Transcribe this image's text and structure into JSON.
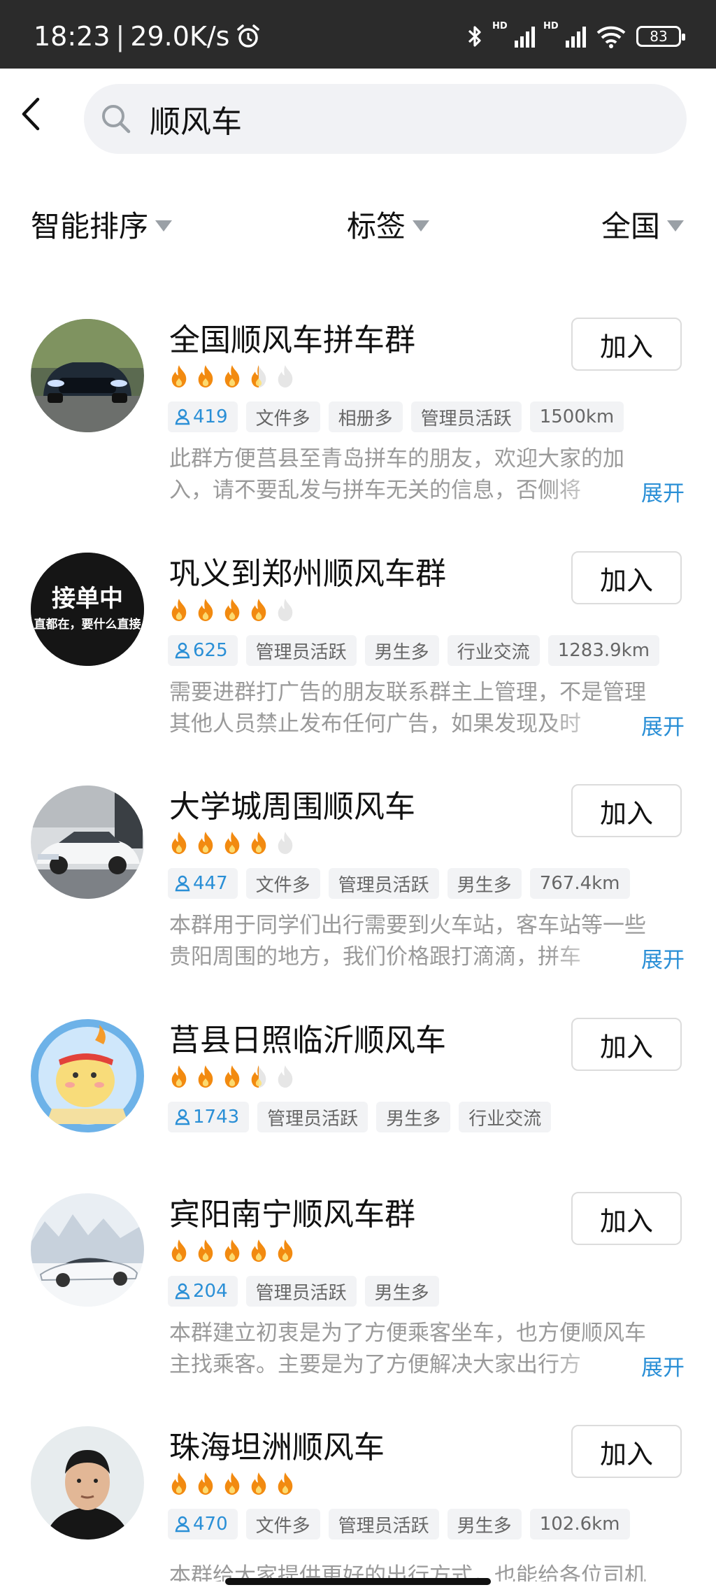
{
  "status_bar": {
    "time": "18:23",
    "speed": "29.0K/s",
    "battery": "83",
    "network_label": "HD",
    "icons": [
      "alarm-icon",
      "bluetooth-icon",
      "signal-icon",
      "wifi-icon",
      "battery-icon"
    ]
  },
  "search": {
    "query": "顺风车"
  },
  "filters": [
    {
      "label": "智能排序"
    },
    {
      "label": "标签"
    },
    {
      "label": "全国"
    }
  ],
  "colors": {
    "accent": "#2a8fd6",
    "flame": "#f28a10",
    "tag_bg": "#f2f3f5"
  },
  "join_label": "加入",
  "expand_label": "展开",
  "groups": [
    {
      "title": "全国顺风车拼车群",
      "rating": 3.5,
      "members": "419",
      "tags": [
        "文件多",
        "相册多",
        "管理员活跃",
        "1500km"
      ],
      "desc1": "此群方便莒县至青岛拼车的朋友，欢迎大家的加",
      "desc2": "入，请不要乱发与拼车无关的信息，否侧将"
    },
    {
      "title": "巩义到郑州顺风车群",
      "rating": 4,
      "members": "625",
      "tags": [
        "管理员活跃",
        "男生多",
        "行业交流",
        "1283.9km"
      ],
      "desc1": "需要进群打广告的朋友联系群主上管理，不是管理",
      "desc2": "其他人员禁止发布任何广告，如果发现及时",
      "avatar_text1": "接单中",
      "avatar_text2": "直都在，要什么直接"
    },
    {
      "title": "大学城周围顺风车",
      "rating": 4,
      "members": "447",
      "tags": [
        "文件多",
        "管理员活跃",
        "男生多",
        "767.4km"
      ],
      "desc1": "本群用于同学们出行需要到火车站，客车站等一些",
      "desc2": "贵阳周围的地方，我们价格跟打滴滴，拼车"
    },
    {
      "title": "莒县日照临沂顺风车",
      "rating": 3.5,
      "members": "1743",
      "tags": [
        "管理员活跃",
        "男生多",
        "行业交流"
      ],
      "desc1": "",
      "desc2": ""
    },
    {
      "title": "宾阳南宁顺风车群",
      "rating": 5,
      "members": "204",
      "tags": [
        "管理员活跃",
        "男生多"
      ],
      "desc1": "本群建立初衷是为了方便乘客坐车，也方便顺风车",
      "desc2": "主找乘客。主要是为了方便解决大家出行方"
    },
    {
      "title": "珠海坦洲顺风车",
      "rating": 5,
      "members": "470",
      "tags": [
        "文件多",
        "管理员活跃",
        "男生多",
        "102.6km"
      ],
      "desc1": "本群给大家提供更好的出行方式，也能给各位司机",
      "desc2": ""
    }
  ]
}
